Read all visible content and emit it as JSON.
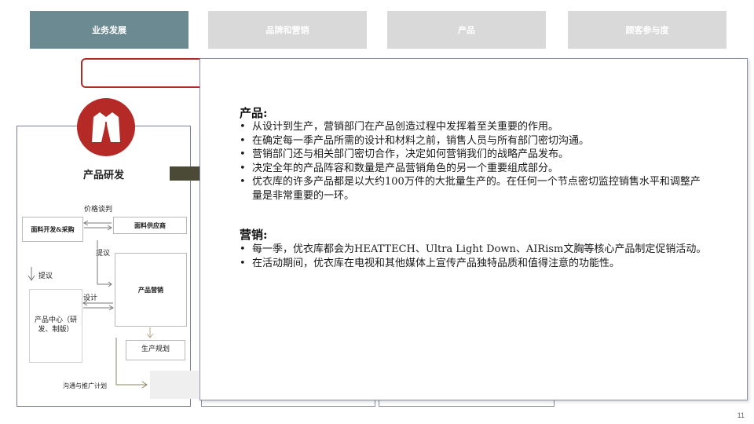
{
  "tabs": [
    {
      "label": "业务发展",
      "active": true
    },
    {
      "label": "品牌和营销",
      "active": false
    },
    {
      "label": "产品",
      "active": false
    },
    {
      "label": "顾客参与度",
      "active": false
    }
  ],
  "diagram": {
    "title": "产品研发",
    "price_negotiation": "价格谈判",
    "fabric_dev": "面料开发&采购",
    "fabric_supplier": "面料供应商",
    "propose_1": "提议",
    "propose_2": "提议",
    "product_marketing": "产品营销",
    "design": "设计",
    "product_center": "产品中心（研发、制版）",
    "production_planning": "生产规划",
    "comm_plan": "沟通与推广计划"
  },
  "popup": {
    "product_heading": "产品:",
    "product_bullets": [
      "从设计到生产，营销部门在产品创造过程中发挥着至关重要的作用。",
      "在确定每一季产品所需的设计和材料之前，销售人员与所有部门密切沟通。",
      "营销部门还与相关部门密切合作，决定如何营销我们的战略产品发布。",
      "决定全年的产品阵容和数量是产品营销角色的另一个重要组成部分。",
      "优衣库的许多产品都是以大约100万件的大批量生产的。在任何一个节点密切监控销售水平和调整产量是非常重要的一环。"
    ],
    "marketing_heading": "营销:",
    "marketing_bullets": [
      "每一季，优衣库都会为HEATTECH、Ultra Light Down、AIRism文胸等核心产品制定促销活动。",
      "在活动期间，优衣库在电视和其他媒体上宣传产品独特品质和值得注意的功能性。"
    ]
  },
  "page_number": "11",
  "colors": {
    "active_tab": "#6b8a92",
    "inactive_tab": "#d9d9d9",
    "accent_red": "#b52a26",
    "arrow": "#4a4a36"
  }
}
